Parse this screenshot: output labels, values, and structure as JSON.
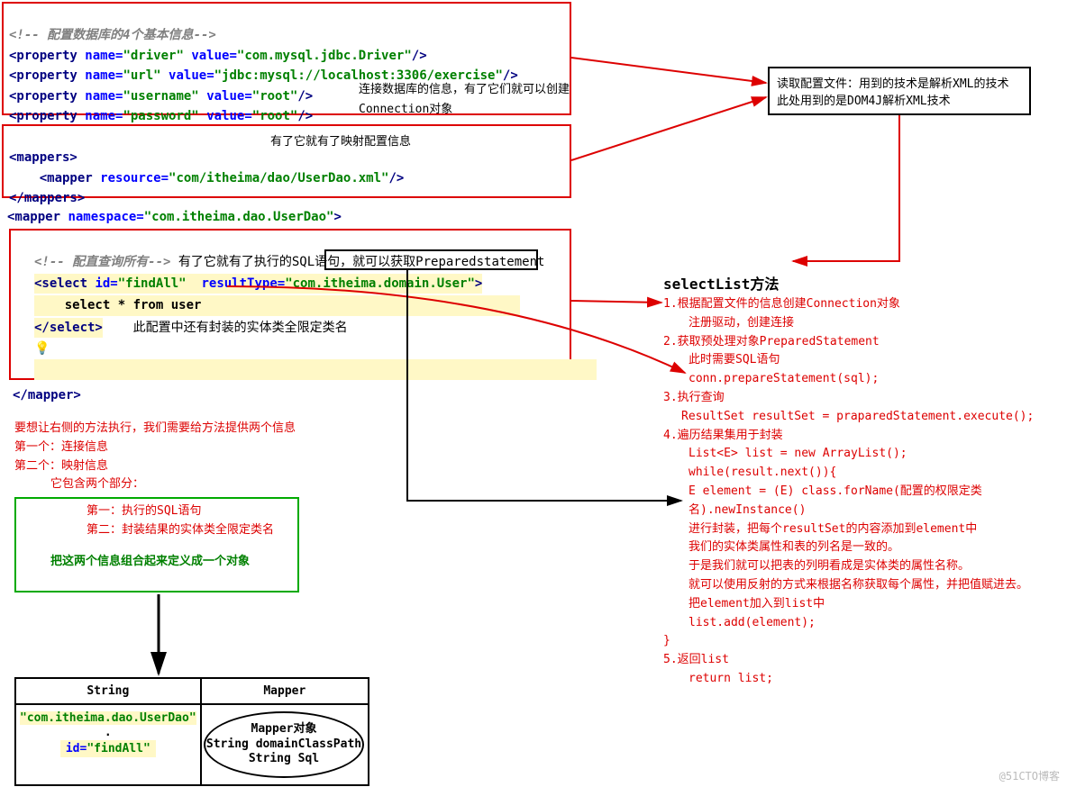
{
  "block1": {
    "comment": "<!-- 配置数据库的4个基本信息-->",
    "l1_a": "<property",
    "l1_b": "name=",
    "l1_c": "\"driver\"",
    "l1_d": "value=",
    "l1_e": "\"com.mysql.jdbc.Driver\"",
    "l1_f": "/>",
    "l2_a": "<property",
    "l2_b": "name=",
    "l2_c": "\"url\"",
    "l2_d": "value=",
    "l2_e": "\"jdbc:mysql://localhost:3306/exercise\"",
    "l2_f": "/>",
    "l3_a": "<property",
    "l3_b": "name=",
    "l3_c": "\"username\"",
    "l3_d": "value=",
    "l3_e": "\"root\"",
    "l3_f": "/>",
    "l4_a": "<property",
    "l4_b": "name=",
    "l4_c": "\"password\"",
    "l4_d": "value=",
    "l4_e": "\"root\"",
    "l4_f": "/>",
    "note1": "连接数据库的信息，有了它们就可以创建",
    "note2": "Connection对象"
  },
  "block2": {
    "l1": "<mappers>",
    "l2_a": "<mapper",
    "l2_b": "resource=",
    "l2_c": "\"com/itheima/dao/UserDao.xml\"",
    "l2_d": "/>",
    "l3": "</mappers>",
    "note": "有了它就有了映射配置信息"
  },
  "line_ns": {
    "a": "<mapper",
    "b": "namespace=",
    "c": "\"com.itheima.dao.UserDao\"",
    "d": ">"
  },
  "block3": {
    "comment": "<!-- 配直查询所有-->",
    "note1": "有了它就有了执行的SQL语句，就可以获取Preparedstatement",
    "sel_a": "<select",
    "sel_b": "id=",
    "sel_c": "\"findAll\"",
    "sel_d": "resultType=",
    "sel_e": "\"com.itheima.domain.User\"",
    "sel_f": ">",
    "sql": "select * from user",
    "close_sel": "</select>",
    "note2": "此配置中还有封装的实体类全限定类名",
    "close_mapper": "</mapper>"
  },
  "xmlbox": {
    "l1": "读取配置文件：用到的技术是解析XML的技术",
    "l2": "此处用到的是DOM4J解析XML技术"
  },
  "sel_title": "selectList方法",
  "steps": {
    "s1": "1.根据配置文件的信息创建Connection对象",
    "s1a": "注册驱动，创建连接",
    "s2": "2.获取预处理对象PreparedStatement",
    "s2a": "此时需要SQL语句",
    "s2b": "conn.prepareStatement(sql);",
    "s3": "3.执行查询",
    "s3a": "ResultSet resultSet = praparedStatement.execute();",
    "s4": "4.遍历结果集用于封装",
    "s4a": "List<E> list = new ArrayList();",
    "s4b": "while(result.next()){",
    "s4c": "E element = (E) class.forName(配置的权限定类名).newInstance()",
    "s4d": "进行封装，把每个resultSet的内容添加到element中",
    "s4e": "我们的实体类属性和表的列名是一致的。",
    "s4f": "于是我们就可以把表的列明看成是实体类的属性名称。",
    "s4g": "就可以使用反射的方式来根据名称获取每个属性，并把值赋进去。",
    "s4h": "把element加入到list中",
    "s4i": "list.add(element);",
    "s4j": "}",
    "s5": "5.返回list",
    "s5a": "return list;"
  },
  "leftnotes": {
    "l1": "要想让右侧的方法执行，我们需要给方法提供两个信息",
    "l2": "第一个：连接信息",
    "l3": "第二个：映射信息",
    "l4": "它包含两个部分：",
    "l5": "第一：执行的SQL语句",
    "l6": "第二：封装结果的实体类全限定类名",
    "l7": "把这两个信息组合起来定义成一个对象"
  },
  "table": {
    "h1": "String",
    "h2": "Mapper",
    "c1a": "\"com.itheima.dao.UserDao\"",
    "c1b": ".",
    "c1c_a": "id=",
    "c1c_b": "\"findAll\""
  },
  "ellipse": {
    "l1": "Mapper对象",
    "l2": "String domainClassPath",
    "l3": "String Sql"
  },
  "watermark": "@51CTO博客"
}
